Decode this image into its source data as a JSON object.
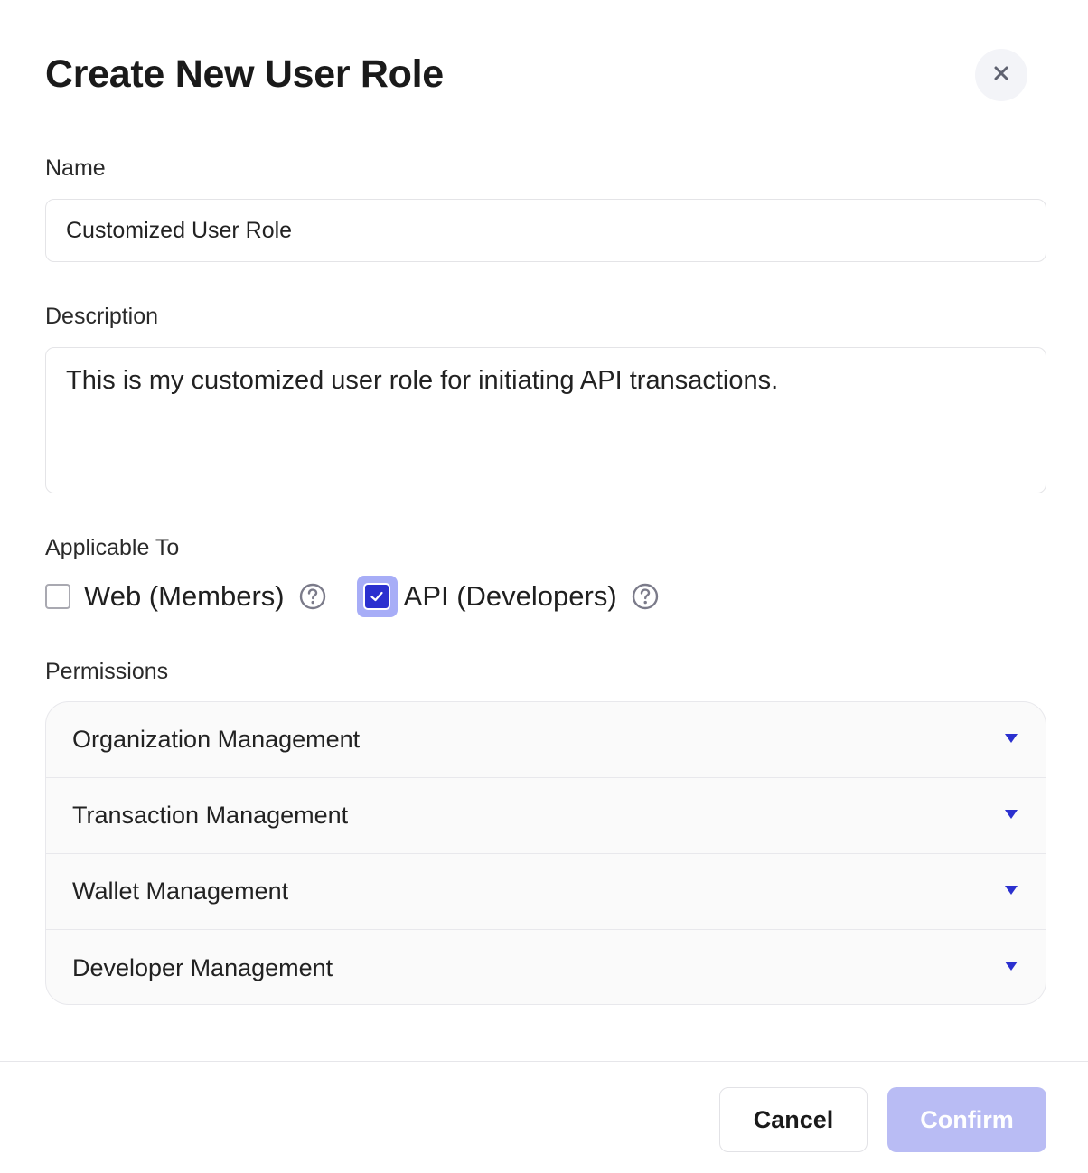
{
  "dialog": {
    "title": "Create New User Role",
    "close_icon": "close-icon"
  },
  "name_field": {
    "label": "Name",
    "value": "Customized User Role"
  },
  "description_field": {
    "label": "Description",
    "value": "This is my customized user role for initiating API transactions."
  },
  "applicable_to": {
    "label": "Applicable To",
    "options": [
      {
        "label": "Web (Members)",
        "checked": false,
        "help_icon": "help-circle-icon"
      },
      {
        "label": "API (Developers)",
        "checked": true,
        "help_icon": "help-circle-icon"
      }
    ]
  },
  "permissions": {
    "label": "Permissions",
    "items": [
      {
        "label": "Organization Management"
      },
      {
        "label": "Transaction Management"
      },
      {
        "label": "Wallet Management"
      },
      {
        "label": "Developer Management"
      }
    ]
  },
  "footer": {
    "cancel_label": "Cancel",
    "confirm_label": "Confirm",
    "confirm_disabled": true
  },
  "colors": {
    "accent": "#2b30cf",
    "accent_light": "#a7adf7",
    "confirm_disabled_bg": "#b9bcf4",
    "help_icon": "#7b7b8a"
  }
}
